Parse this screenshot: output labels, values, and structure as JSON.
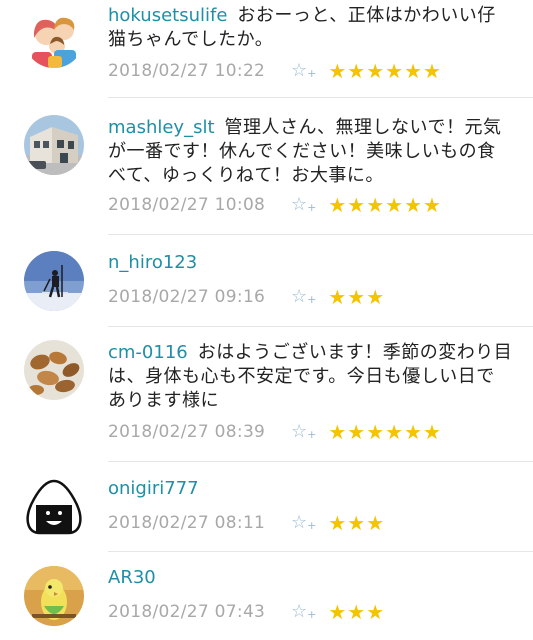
{
  "comments": [
    {
      "username": "hokusetsulife",
      "text": "おおーっと、正体はかわいい仔猫ちゃんでしたか。",
      "timestamp": "2018/02/27 10:22",
      "stars": "★★★★★★",
      "avatar_icon": "family-illustration-icon"
    },
    {
      "username": "mashley_slt",
      "text": "管理人さん、無理しないで！元気が一番です！休んでください！美味しいもの食べて、ゆっくりねて！お大事に。",
      "timestamp": "2018/02/27 10:08",
      "stars": "★★★★★★",
      "avatar_icon": "house-photo-icon"
    },
    {
      "username": "n_hiro123",
      "text": "",
      "timestamp": "2018/02/27 09:16",
      "stars": "★★★",
      "avatar_icon": "skier-photo-icon"
    },
    {
      "username": "cm-0116",
      "text": "おはようございます！季節の変わり目は、身体も心も不安定です。今日も優しい日であります様に",
      "timestamp": "2018/02/27 08:39",
      "stars": "★★★★★★",
      "avatar_icon": "nuts-photo-icon"
    },
    {
      "username": "onigiri777",
      "text": "",
      "timestamp": "2018/02/27 08:11",
      "stars": "★★★",
      "avatar_icon": "onigiri-face-icon"
    },
    {
      "username": "AR30",
      "text": "",
      "timestamp": "2018/02/27 07:43",
      "stars": "★★★",
      "avatar_icon": "parakeet-photo-icon"
    }
  ],
  "add_star_glyph": "☆",
  "add_star_plus": "+",
  "colors": {
    "username": "#1f8fa6",
    "timestamp": "#a8a8a8",
    "star": "#f4c400",
    "add_star": "#9bbbd4"
  }
}
